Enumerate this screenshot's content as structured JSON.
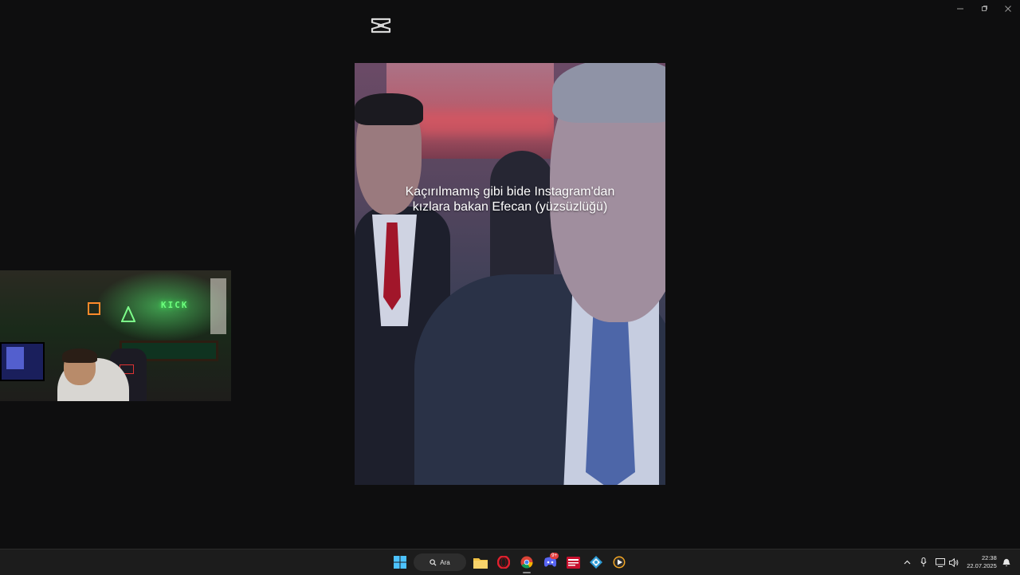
{
  "window": {
    "controls": [
      "minimize",
      "restore",
      "close"
    ]
  },
  "app": {
    "logo_icon": "capcut-logo-icon"
  },
  "video": {
    "caption_line1": "Kaçırılmamış gibi bide Instagram'dan",
    "caption_line2": "kızlara bakan Efecan (yüzsüzlüğü)"
  },
  "webcam": {
    "sign_text": "KICK"
  },
  "taskbar": {
    "search_label": "Ara",
    "apps": [
      "start-icon",
      "search-icon",
      "file-explorer-icon",
      "opera-icon",
      "chrome-icon",
      "discord-icon",
      "news-app-icon",
      "network-app-icon",
      "media-player-icon"
    ],
    "discord_badge": "9+",
    "time": "22:38",
    "date": "22.07.2025",
    "accent": "#0078d4"
  }
}
